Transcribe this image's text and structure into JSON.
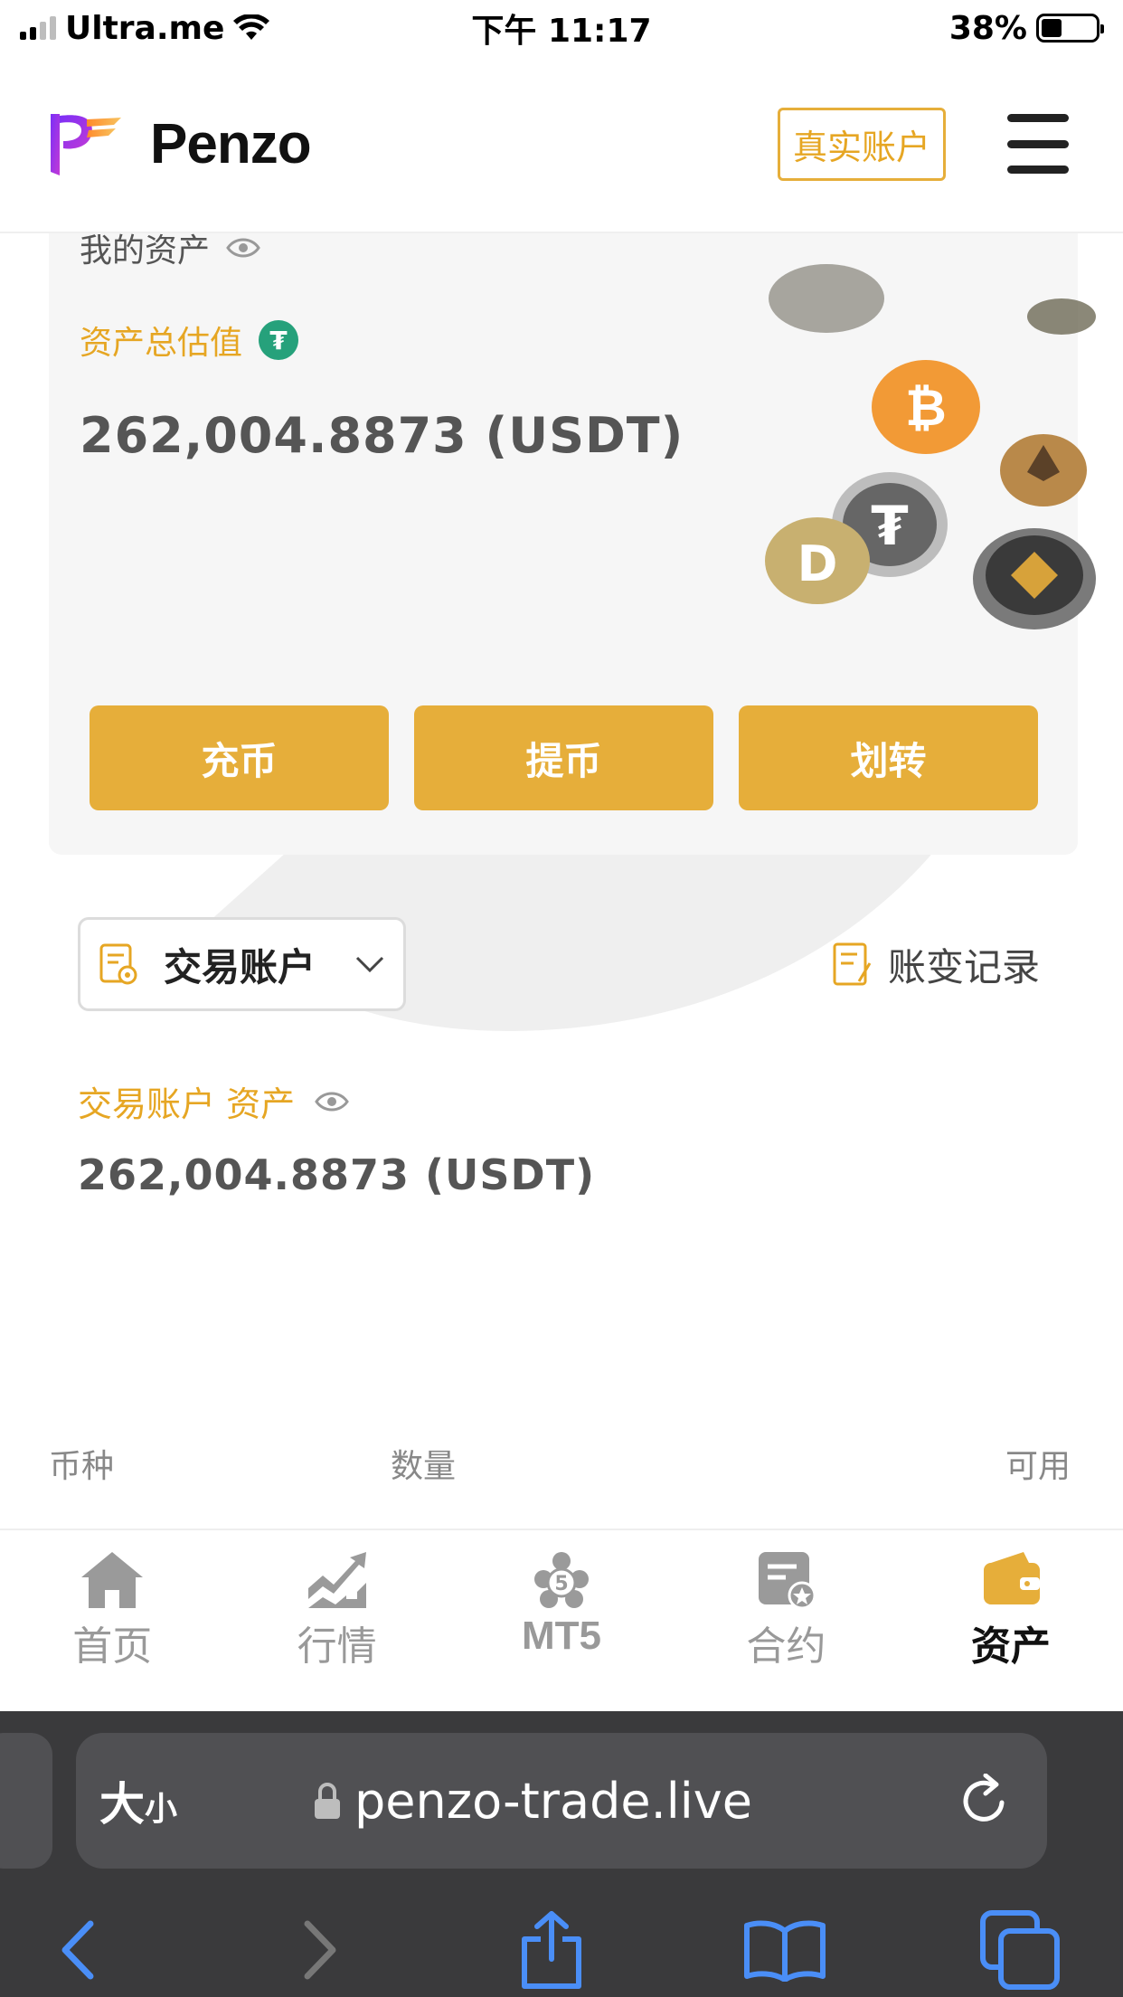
{
  "status_bar": {
    "carrier": "Ultra.me",
    "time": "下午 11:17",
    "battery": "38%",
    "battery_level": 0.38
  },
  "header": {
    "brand": "Penzo",
    "account_type_button": "真实账户",
    "menu_icon": "hamburger-menu-icon"
  },
  "assets_card": {
    "my_assets_label": "我的资产",
    "total_label": "资产总估值",
    "total_value": "262,004.8873 (USDT)",
    "actions": [
      "充币",
      "提币",
      "划转"
    ]
  },
  "account": {
    "selected": "交易账户",
    "records_link": "账变记录",
    "asset_label": "交易账户 资产",
    "asset_value": "262,004.8873 (USDT)"
  },
  "table": {
    "columns": [
      "币种",
      "数量",
      "可用"
    ]
  },
  "tabbar": {
    "items": [
      {
        "label": "首页",
        "icon": "home-icon",
        "active": false
      },
      {
        "label": "行情",
        "icon": "market-chart-icon",
        "active": false
      },
      {
        "label": "MT5",
        "icon": "mt5-icon",
        "active": false
      },
      {
        "label": "合约",
        "icon": "contract-icon",
        "active": false
      },
      {
        "label": "资产",
        "icon": "wallet-icon",
        "active": true
      }
    ]
  },
  "browser": {
    "text_size_label": "大",
    "text_size_small": "小",
    "url": "penzo-trade.live"
  },
  "colors": {
    "accent": "#e6ae3a",
    "accent_text": "#e6a623",
    "tether": "#26a17b",
    "browser_bg": "#3a3a3c",
    "browser_icon": "#4a8ef7"
  }
}
